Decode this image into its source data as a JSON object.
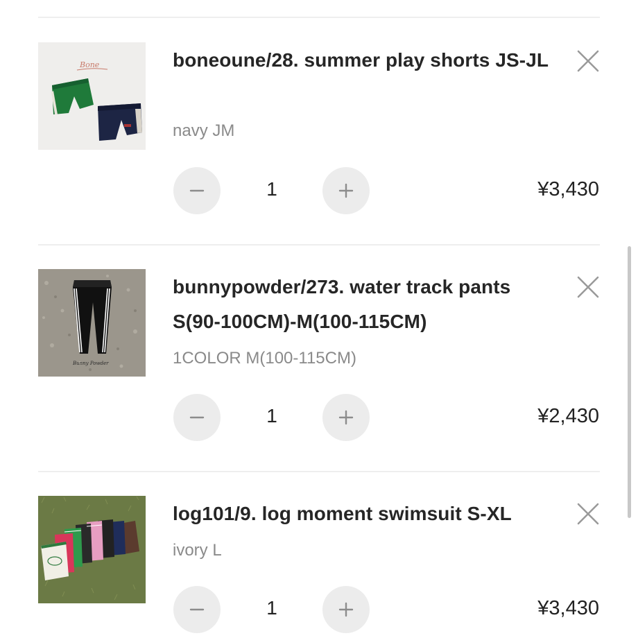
{
  "cart": {
    "items": [
      {
        "name": "boneoune/28. summer play shorts JS-JL",
        "variant": "navy JM",
        "quantity": "1",
        "price": "¥3,430",
        "thumb_logo_text": "Bone"
      },
      {
        "name": "bunnypowder/273. water track pants S(90-100CM)-M(100-115CM)",
        "variant": "1COLOR M(100-115CM)",
        "quantity": "1",
        "price": "¥2,430",
        "thumb_logo_text": "Bunny Powder"
      },
      {
        "name": "log101/9. log moment swimsuit S-XL",
        "variant": "ivory L",
        "quantity": "1",
        "price": "¥3,430",
        "thumb_logo_text": ""
      }
    ]
  },
  "icons": {
    "remove": "close-x-icon",
    "decrease": "minus-icon",
    "increase": "plus-icon"
  },
  "colors": {
    "button_bg": "#ececec",
    "divider": "#eeeeee",
    "variant_text": "#8a8a8a",
    "icon_stroke": "#9a9a9a"
  }
}
